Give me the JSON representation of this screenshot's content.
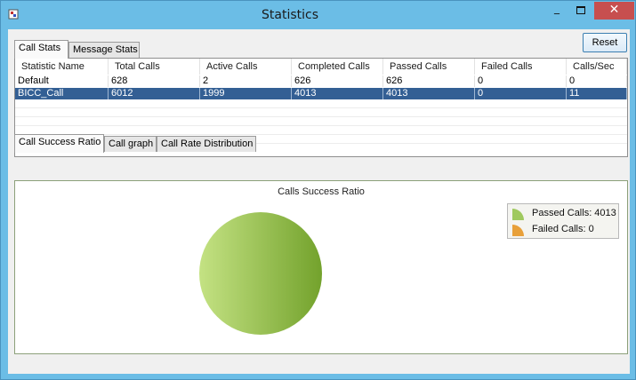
{
  "window": {
    "title": "Statistics",
    "min_label": "_",
    "close_label": "✕"
  },
  "top_tabs": [
    "Call Stats",
    "Message Stats"
  ],
  "reset_label": "Reset",
  "table": {
    "columns": [
      "Statistic Name",
      "Total Calls",
      "Active Calls",
      "Completed Calls",
      "Passed Calls",
      "Failed Calls",
      "Calls/Sec"
    ],
    "rows": [
      [
        "Default",
        "628",
        "2",
        "626",
        "626",
        "0",
        "0"
      ],
      [
        "BICC_Call",
        "6012",
        "1999",
        "4013",
        "4013",
        "0",
        "11"
      ]
    ],
    "selected_row": 1
  },
  "chart_tabs": [
    "Call Success Ratio",
    "Call graph",
    "Call Rate Distribution"
  ],
  "chart_data": {
    "type": "pie",
    "title": "Calls Success Ratio",
    "slices": [
      {
        "label": "Passed Calls",
        "value": 4013,
        "color": "#8cbf4a"
      },
      {
        "label": "Failed Calls",
        "value": 0,
        "color": "#e69b2e"
      }
    ],
    "legend": [
      "Passed Calls: 4013",
      "Failed Calls: 0"
    ],
    "legend_position": "top-right"
  }
}
